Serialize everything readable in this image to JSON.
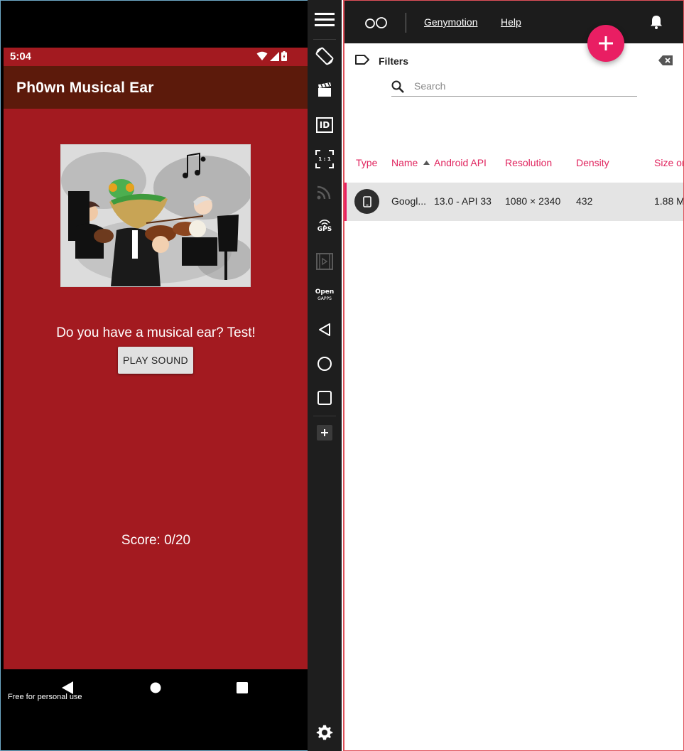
{
  "phone": {
    "status_time": "5:04",
    "app_title": "Ph0wn Musical Ear",
    "question": "Do you have a musical ear? Test!",
    "play_button": "PLAY SOUND",
    "score": "Score: 0/20",
    "watermark": "Free for personal use",
    "colors": {
      "content_bg": "#a31a20",
      "app_bar_bg": "#5c1a0b"
    }
  },
  "toolbar": {
    "items": [
      "menu-icon",
      "rotate-icon",
      "clapperboard-icon",
      "id-icon",
      "pixel-perfect-icon",
      "network-icon",
      "gps-icon",
      "capture-icon",
      "open-gapps-icon",
      "back-icon",
      "home-icon",
      "recents-icon",
      "add-widget-icon",
      "settings-icon"
    ],
    "id_label": "ID",
    "ratio_label": "1 : 1",
    "gps_label": "GPS",
    "open_label": "Open",
    "gapps_label": "GAPPS"
  },
  "launcher": {
    "menu": {
      "genymotion": "Genymotion",
      "help": "Help"
    },
    "filters_label": "Filters",
    "search_placeholder": "Search",
    "columns": [
      "Type",
      "Name",
      "Android API",
      "Resolution",
      "Density",
      "Size on"
    ],
    "sort_column": "Name",
    "rows": [
      {
        "name": "Googl...",
        "api": "13.0 - API 33",
        "resolution": "1080 × 2340",
        "density": "432",
        "size": "1.88 M"
      }
    ],
    "colors": {
      "accent": "#e91e63",
      "header_bg": "#1c1c1c"
    }
  }
}
